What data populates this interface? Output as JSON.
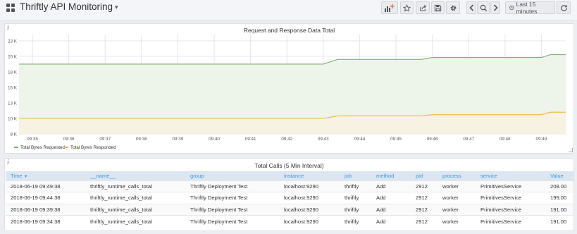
{
  "navbar": {
    "title": "Thriftly API Monitoring",
    "time_range_label": "Last 15 minutes",
    "buttons": [
      {
        "name": "add-panel-button",
        "icon": "bar-chart-plus-icon"
      },
      {
        "name": "star-button",
        "icon": "star-icon"
      },
      {
        "name": "share-button",
        "icon": "share-icon"
      },
      {
        "name": "save-button",
        "icon": "save-icon"
      },
      {
        "name": "settings-button",
        "icon": "gear-icon"
      },
      {
        "name": "time-back-button",
        "icon": "chevron-left-icon"
      },
      {
        "name": "zoom-out-button",
        "icon": "search-icon"
      },
      {
        "name": "time-forward-button",
        "icon": "chevron-right-icon"
      },
      {
        "name": "time-picker-button",
        "icon": "clock-icon"
      },
      {
        "name": "refresh-button",
        "icon": "refresh-icon"
      }
    ]
  },
  "graph_panel": {
    "info": "i",
    "title": "Request and Response Data Total"
  },
  "chart_data": {
    "type": "area",
    "title": "Request and Response Data Total",
    "x": [
      "09:35",
      "09:36",
      "09:37",
      "09:38",
      "09:39",
      "09:40",
      "09:41",
      "09:42",
      "09:43",
      "09:44",
      "09:45",
      "09:46",
      "09:47",
      "09:48",
      "09:49"
    ],
    "y_ticks": [
      "8 K",
      "10 K",
      "13 K",
      "15 K",
      "18 K",
      "20 K",
      "23 K"
    ],
    "y_tick_values": [
      7500,
      10000,
      12500,
      15000,
      17500,
      20000,
      22500
    ],
    "ylim": [
      7500,
      23500
    ],
    "grid": true,
    "legend_position": "bottom-left",
    "series": [
      {
        "name": "Total Bytes Requested",
        "color": "#7eb26d",
        "fill": "#edf4e9",
        "points": [
          [
            0,
            18750
          ],
          [
            8.0,
            18750
          ],
          [
            8.4,
            19500
          ],
          [
            10.7,
            19500
          ],
          [
            11.0,
            19800
          ],
          [
            14.0,
            19800
          ],
          [
            14.25,
            20250
          ],
          [
            14.6,
            20250
          ]
        ]
      },
      {
        "name": "Total Bytes Responded",
        "color": "#eab839",
        "fill": "#f7f2e1",
        "points": [
          [
            0,
            10000
          ],
          [
            8.0,
            10000
          ],
          [
            8.4,
            10400
          ],
          [
            10.7,
            10400
          ],
          [
            11.0,
            10600
          ],
          [
            14.0,
            10600
          ],
          [
            14.25,
            11000
          ],
          [
            14.6,
            11000
          ]
        ]
      }
    ]
  },
  "table_panel": {
    "info": "i",
    "title": "Total Calls (5 Min Interval)",
    "columns": [
      "Time",
      "__name__",
      "group",
      "instance",
      "job",
      "method",
      "pid",
      "process",
      "service",
      "Value"
    ],
    "rows": [
      [
        "2018-06-19 09:49:38",
        "thriftly_runtime_calls_total",
        "Thriftly Deployment Test",
        "localhost:9290",
        "thriftly",
        "Add",
        "2912",
        "worker",
        "PrimitivesService",
        "208.00"
      ],
      [
        "2018-06-19 09:44:38",
        "thriftly_runtime_calls_total",
        "Thriftly Deployment Test",
        "localhost:9290",
        "thriftly",
        "Add",
        "2912",
        "worker",
        "PrimitivesService",
        "199.00"
      ],
      [
        "2018-06-19 09:39:38",
        "thriftly_runtime_calls_total",
        "Thriftly Deployment Test",
        "localhost:9290",
        "thriftly",
        "Add",
        "2912",
        "worker",
        "PrimitivesService",
        "191.00"
      ],
      [
        "2018-06-19 09:34:38",
        "thriftly_runtime_calls_total",
        "Thriftly Deployment Test",
        "localhost:9290",
        "thriftly",
        "Add",
        "2912",
        "worker",
        "PrimitivesService",
        "191.00"
      ]
    ]
  }
}
